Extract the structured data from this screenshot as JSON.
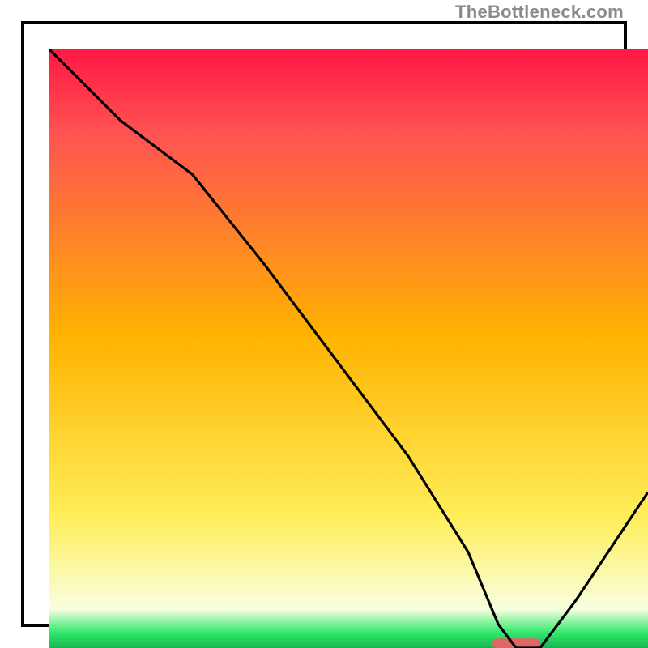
{
  "watermark": "TheBottleneck.com",
  "colors": {
    "top": "#ff1744",
    "upper": "#ff5252",
    "mid": "#ffb300",
    "lower": "#ffee58",
    "pale": "#f8ffe0",
    "green": "#2ee86b",
    "dark_green": "#18b552",
    "marker": "#e06666",
    "frame": "#000000"
  },
  "chart_data": {
    "type": "line",
    "title": "",
    "xlabel": "",
    "ylabel": "",
    "xlim": [
      0,
      100
    ],
    "ylim": [
      0,
      100
    ],
    "x": [
      0,
      12,
      24,
      36,
      48,
      60,
      70,
      75,
      78,
      82,
      88,
      94,
      100
    ],
    "values": [
      100,
      88,
      79,
      64,
      48,
      32,
      16,
      4,
      0,
      0,
      8,
      17,
      26
    ],
    "marker": {
      "x_start": 74,
      "x_end": 82,
      "y": 0.8,
      "height": 1.6
    },
    "annotations": []
  }
}
